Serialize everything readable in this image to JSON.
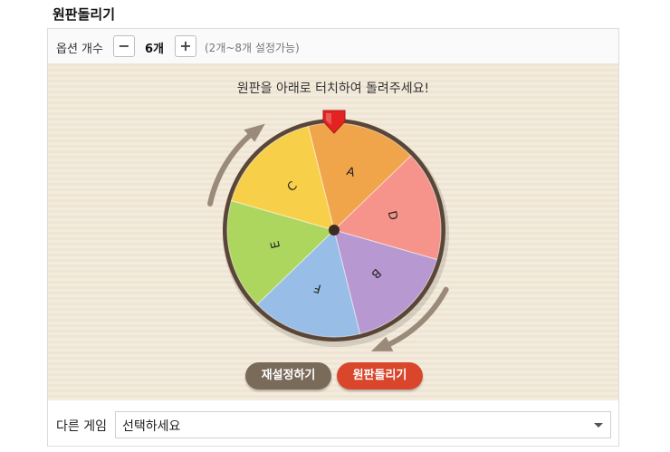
{
  "title": "원판돌리기",
  "options": {
    "label": "옵션 개수",
    "minus": "−",
    "plus": "+",
    "count": "6개",
    "hint": "(2개~8개 설정가능)"
  },
  "instruction": "원판을 아래로 터치하여 돌려주세요!",
  "wheel": {
    "segments": [
      {
        "label": "A",
        "color": "#f0a54a"
      },
      {
        "label": "D",
        "color": "#f6938a"
      },
      {
        "label": "B",
        "color": "#b898d0"
      },
      {
        "label": "F",
        "color": "#98bde6"
      },
      {
        "label": "E",
        "color": "#acd65e"
      },
      {
        "label": "C",
        "color": "#f8cf48"
      }
    ],
    "rim_color": "#5a4636",
    "pointer_color": "#e32222",
    "arrow_color": "#9a8a79"
  },
  "buttons": {
    "reset": "재설정하기",
    "spin": "원판돌리기"
  },
  "game_select": {
    "label": "다른 게임",
    "value": "선택하세요"
  }
}
